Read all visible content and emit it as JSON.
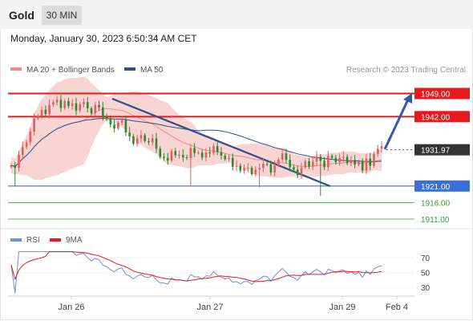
{
  "header": {
    "instrument": "Gold",
    "timeframe": "30 MIN"
  },
  "datetime": "Monday, January 30, 2023 6:50:34 AM CET",
  "legend": {
    "bb_label": "MA 20 + Bollinger Bands",
    "ma50_label": "MA 50"
  },
  "copyright": "Research © 2023 Trading Central",
  "colors": {
    "resistance": "#e8191c",
    "support": "#3a6fd8",
    "target": "#3a9a3a",
    "candle_up": "#e06060",
    "candle_down": "#2b8a2b",
    "ma50": "#2c4f8c",
    "band": "#f6c7c4",
    "arrow": "#2e5aa8",
    "rsi": "#6a8ee0",
    "rsi_ma": "#e8191c"
  },
  "chart_data": [
    {
      "type": "candlestick",
      "x_ticks": [
        "Jan 26",
        "Jan 27",
        "Jan 29",
        "Feb 4"
      ],
      "y_range": [
        1906,
        1954
      ],
      "current_price": "1931.97",
      "levels": [
        {
          "value": 1949.0,
          "label": "1949.00",
          "kind": "resistance"
        },
        {
          "value": 1942.0,
          "label": "1942.00",
          "kind": "resistance"
        },
        {
          "value": 1921.0,
          "label": "1921.00",
          "kind": "support"
        },
        {
          "value": 1916.0,
          "label": "1916.00",
          "kind": "target"
        },
        {
          "value": 1911.0,
          "label": "1911.00",
          "kind": "target"
        }
      ],
      "series": [
        {
          "name": "MA 20 + Bollinger Bands"
        },
        {
          "name": "MA 50"
        }
      ],
      "close": [
        1927.3,
        1926.5,
        1930.4,
        1932.8,
        1934.2,
        1937.5,
        1941.4,
        1942.2,
        1944.1,
        1942.8,
        1945.6,
        1946.3,
        1947.1,
        1944.6,
        1946.7,
        1945.2,
        1946.0,
        1943.8,
        1945.7,
        1946.4,
        1944.5,
        1943.0,
        1945.5,
        1944.8,
        1942.1,
        1941.3,
        1939.6,
        1938.4,
        1940.2,
        1941.0,
        1937.2,
        1936.0,
        1933.8,
        1935.4,
        1936.4,
        1934.6,
        1934.2,
        1935.4,
        1932.3,
        1929.8,
        1929.5,
        1928.7,
        1931.6,
        1930.3,
        1930.4,
        1929.7,
        1929.5,
        1932.5,
        1931.0,
        1931.1,
        1929.6,
        1931.1,
        1931.0,
        1933.1,
        1931.3,
        1930.2,
        1929.1,
        1929.5,
        1926.8,
        1927.1,
        1925.6,
        1926.4,
        1926.5,
        1924.6,
        1926.0,
        1926.5,
        1927.7,
        1927.6,
        1925.1,
        1927.2,
        1929.0,
        1930.9,
        1928.9,
        1926.7,
        1926.0,
        1924.3,
        1926.6,
        1928.5,
        1926.9,
        1928.4,
        1929.9,
        1928.6,
        1926.7,
        1930.1,
        1929.5,
        1928.2,
        1929.5,
        1929.8,
        1927.9,
        1928.9,
        1927.5,
        1928.4,
        1925.7,
        1929.3,
        1927.1,
        1930.7,
        1932.3,
        1933.1
      ],
      "rsi": {
        "name": "RSI",
        "ma_name": "9MA",
        "ticks": [
          "70",
          "50",
          "30"
        ],
        "y_range": [
          20,
          80
        ]
      }
    }
  ]
}
